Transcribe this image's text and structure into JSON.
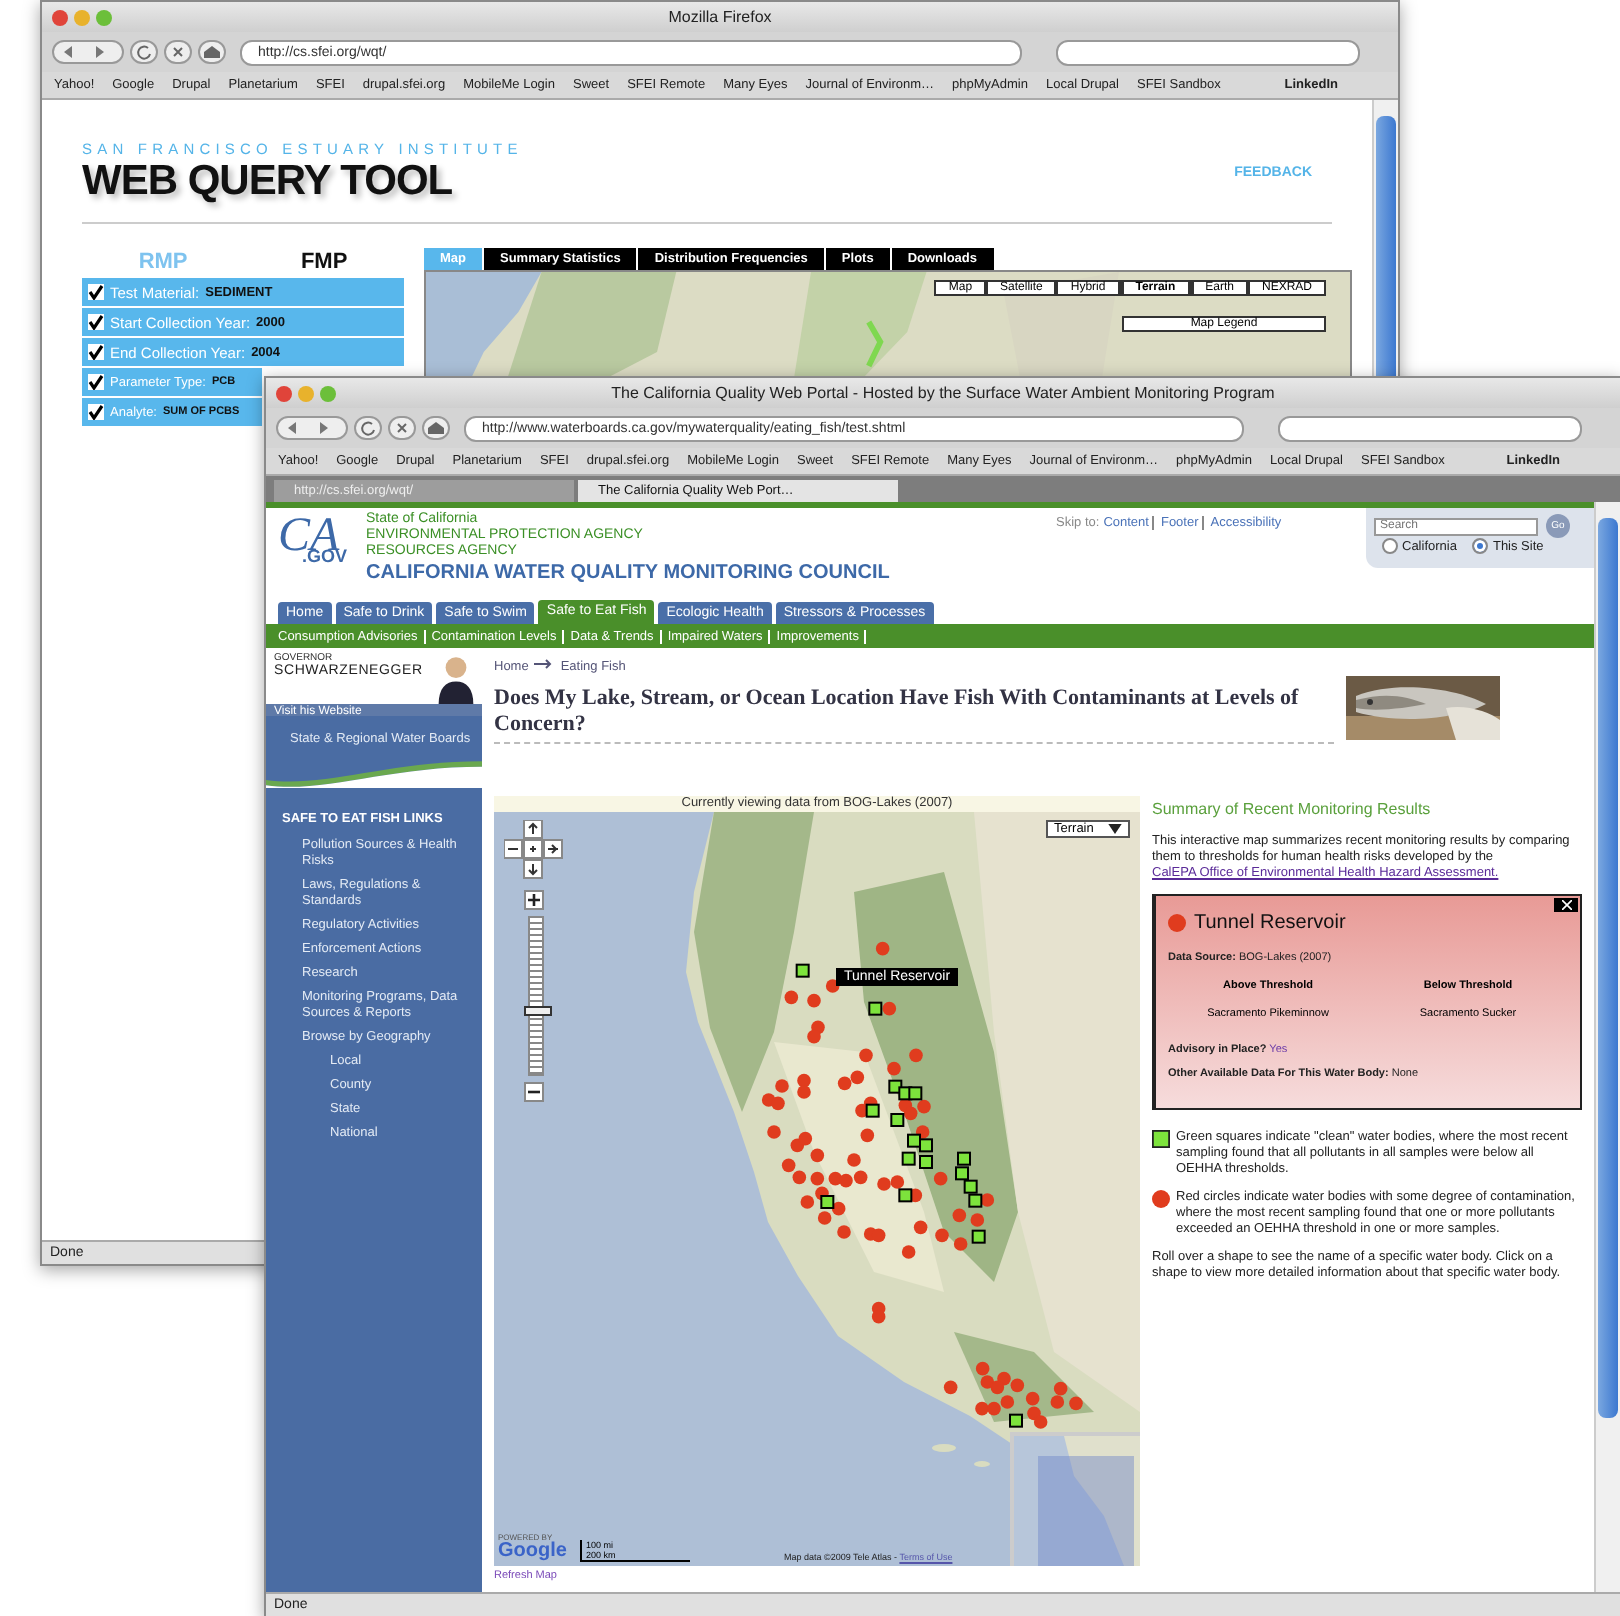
{
  "back_window": {
    "title": "Mozilla Firefox",
    "url": "http://cs.sfei.org/wqt/",
    "bookmarks": [
      "Yahoo!",
      "Google",
      "Drupal",
      "Planetarium",
      "SFEI",
      "drupal.sfei.org",
      "MobileMe Login",
      "Sweet",
      "SFEI Remote",
      "Many Eyes",
      "Journal of Environm…",
      "phpMyAdmin",
      "Local Drupal",
      "SFEI Sandbox",
      "LinkedIn"
    ],
    "page": {
      "org": "SAN FRANCISCO ESTUARY INSTITUTE",
      "title": "WEB QUERY TOOL",
      "feedback": "FEEDBACK",
      "programs": [
        {
          "label": "RMP",
          "selected": true
        },
        {
          "label": "FMP",
          "selected": false
        }
      ],
      "filters": [
        {
          "label": "Test Material:",
          "value": "SEDIMENT",
          "checked": true
        },
        {
          "label": "Start Collection Year:",
          "value": "2000",
          "checked": true
        },
        {
          "label": "End Collection Year:",
          "value": "2004",
          "checked": true
        },
        {
          "label": "Parameter Type:",
          "value": "PCB",
          "checked": true
        },
        {
          "label": "Analyte:",
          "value": "SUM OF PCBS",
          "checked": true
        }
      ],
      "tabs": [
        {
          "label": "Map",
          "selected": true
        },
        {
          "label": "Summary Statistics",
          "selected": false
        },
        {
          "label": "Distribution Frequencies",
          "selected": false
        },
        {
          "label": "Plots",
          "selected": false
        },
        {
          "label": "Downloads",
          "selected": false
        }
      ],
      "map_types": [
        {
          "label": "Map",
          "selected": false
        },
        {
          "label": "Satellite",
          "selected": false
        },
        {
          "label": "Hybrid",
          "selected": false
        },
        {
          "label": "Terrain",
          "selected": true
        },
        {
          "label": "Earth",
          "selected": false
        },
        {
          "label": "NEXRAD",
          "selected": false
        }
      ],
      "legend_title": "Map Legend"
    },
    "status": "Done"
  },
  "front_window": {
    "title": "The California Quality Web Portal - Hosted by the Surface Water Ambient Monitoring Program",
    "url": "http://www.waterboards.ca.gov/mywaterquality/eating_fish/test.shtml",
    "bookmarks": [
      "Yahoo!",
      "Google",
      "Drupal",
      "Planetarium",
      "SFEI",
      "drupal.sfei.org",
      "MobileMe Login",
      "Sweet",
      "SFEI Remote",
      "Many Eyes",
      "Journal of Environm…",
      "phpMyAdmin",
      "Local Drupal",
      "SFEI Sandbox",
      "LinkedIn"
    ],
    "tabs": [
      {
        "label": "http://cs.sfei.org/wqt/",
        "selected": false
      },
      {
        "label": "The California Quality Web Port…",
        "selected": true
      }
    ],
    "page": {
      "logo": {
        "top": "CA",
        "bottom": ".GOV"
      },
      "agency_lines": [
        "State of California",
        "ENVIRONMENTAL PROTECTION AGENCY",
        "RESOURCES AGENCY"
      ],
      "council": "CALIFORNIA WATER QUALITY MONITORING COUNCIL",
      "skip_label": "Skip to:",
      "skip_links": [
        "Content",
        "Footer",
        "Accessibility"
      ],
      "search": {
        "placeholder": "Search",
        "button": "Go",
        "scopes": [
          {
            "label": "California",
            "selected": false
          },
          {
            "label": "This Site",
            "selected": true
          }
        ]
      },
      "nav": [
        {
          "label": "Home",
          "selected": false
        },
        {
          "label": "Safe to Drink",
          "selected": false
        },
        {
          "label": "Safe to Swim",
          "selected": false
        },
        {
          "label": "Safe to Eat Fish",
          "selected": true
        },
        {
          "label": "Ecologic Health",
          "selected": false
        },
        {
          "label": "Stressors & Processes",
          "selected": false
        }
      ],
      "subnav": [
        "Consumption Advisories",
        "Contamination Levels",
        "Data & Trends",
        "Impaired Waters",
        "Improvements"
      ],
      "governor": {
        "role": "GOVERNOR",
        "name": "SCHWARZENEGGER",
        "link": "Visit his Website"
      },
      "sidebar": {
        "top_link": "State & Regional Water Boards",
        "heading": "SAFE TO EAT FISH LINKS",
        "items": [
          {
            "label": "Pollution Sources & Health Risks"
          },
          {
            "label": "Laws, Regulations & Standards"
          },
          {
            "label": "Regulatory Activities"
          },
          {
            "label": "Enforcement Actions"
          },
          {
            "label": "Research"
          },
          {
            "label": "Monitoring Programs, Data Sources & Reports"
          },
          {
            "label": "Browse by Geography",
            "children": [
              {
                "label": "Local"
              },
              {
                "label": "County"
              },
              {
                "label": "State"
              },
              {
                "label": "National"
              }
            ]
          }
        ]
      },
      "breadcrumb": [
        "Home",
        "Eating Fish"
      ],
      "heading": "Does My Lake, Stream, or Ocean Location Have Fish With Contaminants at Levels of Concern?",
      "map": {
        "caption": "Currently viewing data from BOG-Lakes (2007)",
        "type_menu": "Terrain",
        "tooltip": "Tunnel Reservoir",
        "zoom_slider": {
          "level": 0.43
        },
        "logo_note": "POWERED BY",
        "logo": "Google",
        "scale": [
          "100 mi",
          "200 km"
        ],
        "attribution": "Map data ©2009 Tele Atlas -",
        "terms": "Terms of Use",
        "refresh": "Refresh Map"
      },
      "summary": {
        "title": "Summary of Recent Monitoring Results",
        "intro": "This interactive map summarizes recent monitoring results by comparing them to thresholds for human health risks developed by the",
        "intro_link": "CalEPA Office of Environmental Health Hazard Assessment.",
        "popup": {
          "title": "Tunnel Reservoir",
          "source_label": "Data Source:",
          "source": "BOG-Lakes (2007)",
          "columns": [
            "Above Threshold",
            "Below Threshold"
          ],
          "species": [
            "Sacramento Pikeminnow",
            "Sacramento Sucker"
          ],
          "advisory_label": "Advisory in Place?",
          "advisory": "Yes",
          "other_label": "Other Available Data For This Water Body:",
          "other": "None"
        },
        "legend": [
          {
            "kind": "square",
            "text": "Green squares indicate \"clean\" water bodies, where the most recent sampling found that all pollutants in all samples were below all OEHHA thresholds."
          },
          {
            "kind": "circle",
            "text": "Red circles indicate water bodies with some degree of contamination, where the most recent sampling found that one or more pollutants exceeded an OEHHA threshold in one or more samples."
          }
        ],
        "note": "Roll over a shape to see the name of a specific water body. Click on a shape to view more detailed information about that specific water body."
      }
    },
    "status": "Done"
  }
}
